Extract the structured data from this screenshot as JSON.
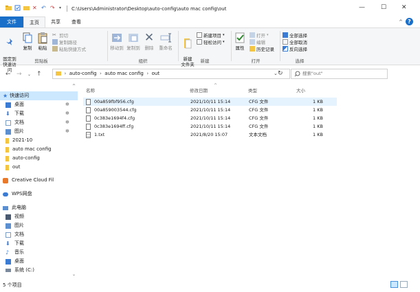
{
  "title_bar": {
    "path": "C:\\Users\\Administrator\\Desktop\\auto-config\\auto mac config\\out",
    "minimize": "—",
    "maximize": "☐",
    "close": "✕"
  },
  "ribbon_tabs": {
    "file": "文件",
    "home": "主页",
    "share": "共享",
    "view": "查看"
  },
  "ribbon": {
    "clipboard": {
      "pin_quick_access": "固定到\n快速访问",
      "copy": "复制",
      "paste": "粘贴",
      "cut": "剪切",
      "copy_path": "复制路径",
      "paste_shortcut": "粘贴快捷方式",
      "label": "剪贴板"
    },
    "organize": {
      "move_to": "移动到",
      "copy_to": "复制到",
      "delete": "删除",
      "rename": "重命名",
      "label": "组织"
    },
    "new": {
      "new_folder": "新建\n文件夹",
      "new_item": "新建项目",
      "easy_access": "轻松访问",
      "label": "新建"
    },
    "open": {
      "properties": "属性",
      "open": "打开",
      "edit": "编辑",
      "history": "历史记录",
      "label": "打开"
    },
    "select": {
      "select_all": "全部选择",
      "select_none": "全部取消",
      "invert": "反向选择",
      "label": "选择"
    }
  },
  "address": {
    "crumbs": [
      "auto-config",
      "auto mac config",
      "out"
    ],
    "search_placeholder": "搜索\"out\""
  },
  "nav": {
    "quick_access": "快速访问",
    "items": [
      {
        "label": "桌面",
        "icon": "desktop-icon",
        "pinned": true
      },
      {
        "label": "下载",
        "icon": "download-icon",
        "pinned": true
      },
      {
        "label": "文档",
        "icon": "document-icon",
        "pinned": true
      },
      {
        "label": "图片",
        "icon": "picture-icon",
        "pinned": true
      },
      {
        "label": "2021-10",
        "icon": "folder-icon",
        "pinned": false
      },
      {
        "label": "auto mac config",
        "icon": "folder-icon",
        "pinned": false
      },
      {
        "label": "auto-config",
        "icon": "folder-icon",
        "pinned": false
      },
      {
        "label": "out",
        "icon": "folder-icon",
        "pinned": false
      }
    ],
    "creative_cloud": "Creative Cloud Fil",
    "wps": "WPS网盘",
    "this_pc": "此电脑",
    "pc_items": [
      {
        "label": "视频",
        "icon": "video-icon"
      },
      {
        "label": "图片",
        "icon": "picture-icon"
      },
      {
        "label": "文档",
        "icon": "document-icon"
      },
      {
        "label": "下载",
        "icon": "download-icon"
      },
      {
        "label": "音乐",
        "icon": "music-icon"
      },
      {
        "label": "桌面",
        "icon": "desktop-icon"
      },
      {
        "label": "系统 (C:)",
        "icon": "drive-icon"
      }
    ]
  },
  "columns": {
    "name": "名称",
    "modified": "修改日期",
    "type": "类型",
    "size": "大小"
  },
  "files": [
    {
      "name": "00a859fbf956.cfg",
      "modified": "2021/10/11 15:14",
      "type": "CFG 文件",
      "size": "1 KB"
    },
    {
      "name": "00a859003544.cfg",
      "modified": "2021/10/11 15:14",
      "type": "CFG 文件",
      "size": "1 KB"
    },
    {
      "name": "0c383e1694f4.cfg",
      "modified": "2021/10/11 15:14",
      "type": "CFG 文件",
      "size": "1 KB"
    },
    {
      "name": "0c383e1694ff.cfg",
      "modified": "2021/10/11 15:14",
      "type": "CFG 文件",
      "size": "1 KB"
    },
    {
      "name": "1.txt",
      "modified": "2021/8/20 15:07",
      "type": "文本文档",
      "size": "1 KB"
    }
  ],
  "status": {
    "item_count": "5 个项目"
  },
  "colors": {
    "accent": "#1a6fc9",
    "selection": "#cce8ff",
    "folder": "#f4c542"
  }
}
